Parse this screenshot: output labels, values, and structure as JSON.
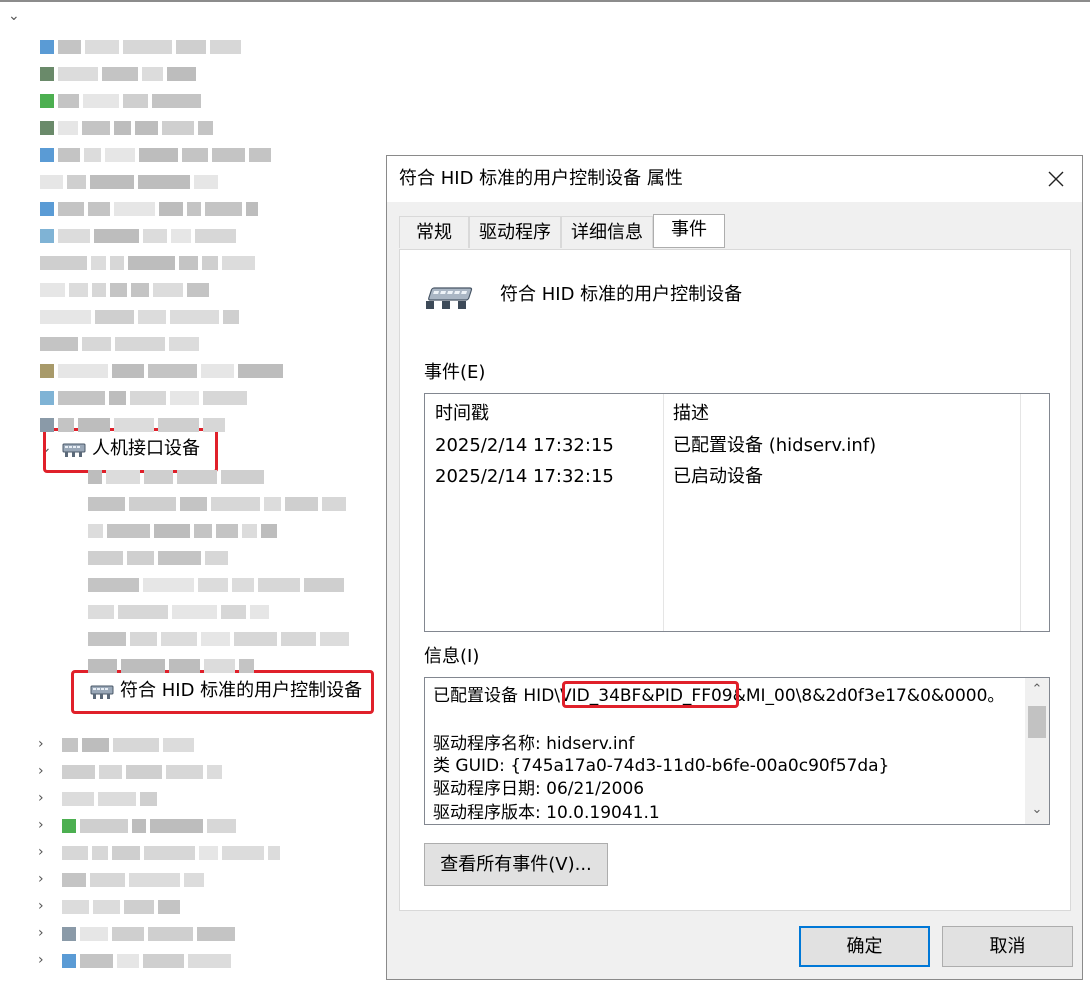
{
  "tree": {
    "category_label": "人机接口设备",
    "selected_device_label": "符合 HID 标准的用户控制设备"
  },
  "dialog": {
    "title": "符合 HID 标准的用户控制设备 属性",
    "tabs": [
      {
        "label": "常规"
      },
      {
        "label": "驱动程序"
      },
      {
        "label": "详细信息"
      },
      {
        "label": "事件"
      }
    ],
    "active_tab": "事件",
    "device_name": "符合 HID 标准的用户控制设备",
    "events_label": "事件(E)",
    "events_columns": [
      "时间戳",
      "描述"
    ],
    "events_rows": [
      {
        "time": "2025/2/14 17:32:15",
        "desc": "已配置设备 (hidserv.inf)"
      },
      {
        "time": "2025/2/14 17:32:15",
        "desc": "已启动设备"
      }
    ],
    "info_label": "信息(I)",
    "info_lines": [
      "已配置设备 HID\\VID_34BF&PID_FF09&MI_00\\8&2d0f3e17&0&0000。",
      "",
      "驱动程序名称: hidserv.inf",
      "类 GUID: {745a17a0-74d3-11d0-b6fe-00a0c90f57da}",
      "驱动程序日期: 06/21/2006",
      "驱动程序版本: 10.0.19041.1"
    ],
    "view_all_button": "查看所有事件(V)...",
    "ok_button": "确定",
    "cancel_button": "取消"
  },
  "colors": {
    "highlight_red": "#e0202a",
    "ok_focus_blue": "#0078d7"
  }
}
